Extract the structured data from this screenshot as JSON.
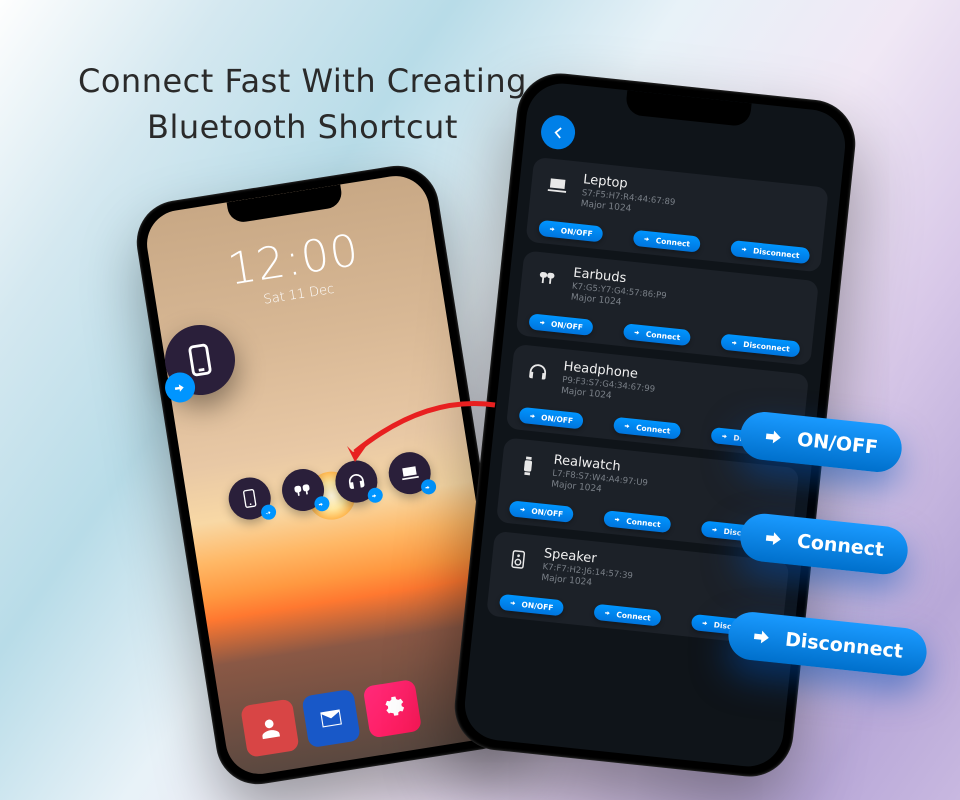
{
  "heading": {
    "line1": "Connect Fast With Creating",
    "line2": "Bluetooth Shortcut"
  },
  "phone1": {
    "time": "12:00",
    "date": "Sat 11 Dec"
  },
  "devices": [
    {
      "name": "Leptop",
      "mac": "S7:F5:H7:R4:44:67:89",
      "major": "Major 1024"
    },
    {
      "name": "Earbuds",
      "mac": "K7:G5:Y7:G4:57:86:P9",
      "major": "Major 1024"
    },
    {
      "name": "Headphone",
      "mac": "P9:F3:S7:G4:34:67:99",
      "major": "Major 1024"
    },
    {
      "name": "Realwatch",
      "mac": "L7:F8:S7:W4:A4:97:U9",
      "major": "Major 1024"
    },
    {
      "name": "Speaker",
      "mac": "K7:F7:H2:J6:14:57:39",
      "major": "Major 1024"
    }
  ],
  "buttons": {
    "onoff": "ON/OFF",
    "connect": "Connect",
    "disconnect": "Disconnect"
  },
  "callouts": {
    "onoff": "ON/OFF",
    "connect": "Connect",
    "disconnect": "Disconnect"
  }
}
